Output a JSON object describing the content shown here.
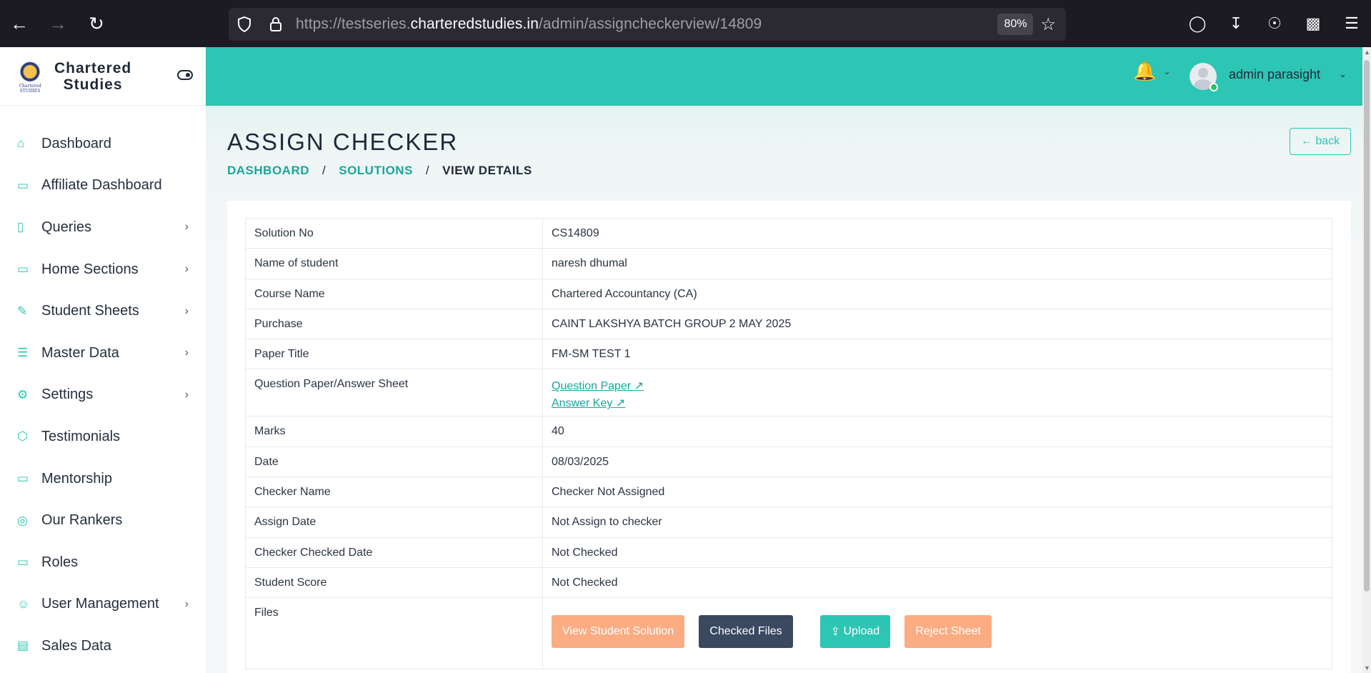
{
  "browser": {
    "url_prefix": "https://testseries.",
    "url_domain": "charteredstudies.in",
    "url_path": "/admin/assigncheckerview/14809",
    "zoom": "80%"
  },
  "brand": {
    "line1": "Chartered",
    "line2": "Studies",
    "logo_text": "Chartered STUDIES"
  },
  "sidebar": {
    "items": [
      {
        "label": "Dashboard",
        "icon": "home-icon",
        "has_children": false
      },
      {
        "label": "Affiliate Dashboard",
        "icon": "monitor-icon",
        "has_children": false
      },
      {
        "label": "Queries",
        "icon": "clipboard-icon",
        "has_children": true
      },
      {
        "label": "Home Sections",
        "icon": "monitor-icon",
        "has_children": true
      },
      {
        "label": "Student Sheets",
        "icon": "pencil-icon",
        "has_children": true
      },
      {
        "label": "Master Data",
        "icon": "list-icon",
        "has_children": true
      },
      {
        "label": "Settings",
        "icon": "gear-icon",
        "has_children": true
      },
      {
        "label": "Testimonials",
        "icon": "box-icon",
        "has_children": false
      },
      {
        "label": "Mentorship",
        "icon": "file-icon",
        "has_children": false
      },
      {
        "label": "Our Rankers",
        "icon": "award-icon",
        "has_children": false
      },
      {
        "label": "Roles",
        "icon": "monitor-icon",
        "has_children": false
      },
      {
        "label": "User Management",
        "icon": "users-icon",
        "has_children": true
      },
      {
        "label": "Sales Data",
        "icon": "bag-icon",
        "has_children": false
      }
    ]
  },
  "header": {
    "user_name": "admin parasight"
  },
  "page": {
    "title": "ASSIGN CHECKER",
    "back_label": "← back",
    "breadcrumb": {
      "item1": "DASHBOARD",
      "item2": "SOLUTIONS",
      "current": "VIEW DETAILS",
      "sep": "/"
    }
  },
  "details": {
    "solution_no": {
      "label": "Solution No",
      "value": "CS14809"
    },
    "student": {
      "label": "Name of student",
      "value": "naresh dhumal"
    },
    "course": {
      "label": "Course Name",
      "value": "Chartered Accountancy (CA)"
    },
    "purchase": {
      "label": "Purchase",
      "value": "CAINT LAKSHYA BATCH GROUP 2 MAY 2025"
    },
    "paper_title": {
      "label": "Paper Title",
      "value": "FM-SM TEST 1"
    },
    "qp_as": {
      "label": "Question Paper/Answer Sheet",
      "link1": "Question Paper",
      "link2": "Answer Key"
    },
    "marks": {
      "label": "Marks",
      "value": "40"
    },
    "date": {
      "label": "Date",
      "value": "08/03/2025"
    },
    "checker_name": {
      "label": "Checker Name",
      "value": "Checker Not Assigned"
    },
    "assign_date": {
      "label": "Assign Date",
      "value": "Not Assign to checker"
    },
    "checked_date": {
      "label": "Checker Checked Date",
      "value": "Not Checked"
    },
    "score": {
      "label": "Student Score",
      "value": "Not Checked"
    },
    "files": {
      "label": "Files"
    }
  },
  "buttons": {
    "view_solution": "View Student Solution",
    "checked_files": "Checked Files",
    "upload": "Upload",
    "reject": "Reject Sheet"
  },
  "colors": {
    "accent": "#2dc5b3",
    "orange": "#fbac82",
    "dark": "#3a4860"
  }
}
